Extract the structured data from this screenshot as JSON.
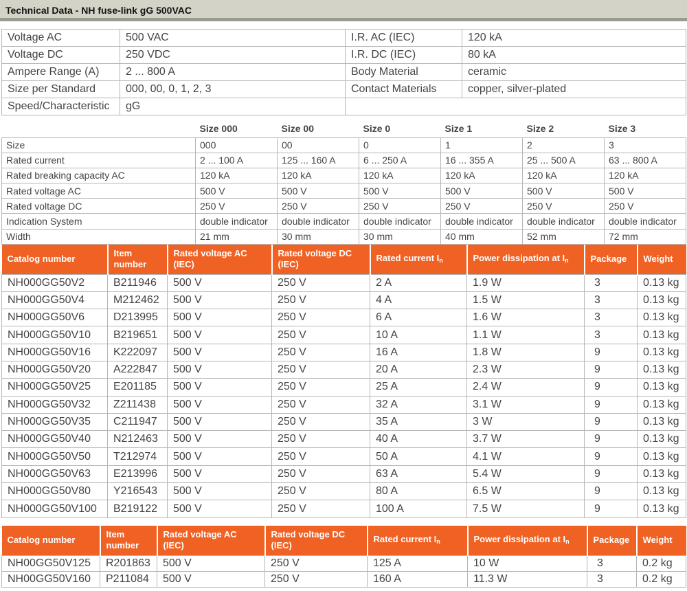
{
  "title": "Technical Data - NH fuse-link gG 500VAC",
  "overview": {
    "rows": [
      [
        {
          "l": "Voltage AC",
          "v": "500 VAC"
        },
        {
          "l": "I.R. AC (IEC)",
          "v": "120 kA"
        }
      ],
      [
        {
          "l": "Voltage DC",
          "v": "250 VDC"
        },
        {
          "l": "I.R. DC (IEC)",
          "v": "80 kA"
        }
      ],
      [
        {
          "l": "Ampere Range (A)",
          "v": "2 ... 800 A"
        },
        {
          "l": "Body Material",
          "v": "ceramic"
        }
      ],
      [
        {
          "l": "Size per Standard",
          "v": "000, 00, 0, 1, 2, 3"
        },
        {
          "l": "Contact Materials",
          "v": "copper, silver-plated"
        }
      ],
      [
        {
          "l": "Speed/Characteristic",
          "v": "gG"
        },
        null
      ]
    ]
  },
  "sizes": {
    "headers": [
      "Size 000",
      "Size 00",
      "Size 0",
      "Size 1",
      "Size 2",
      "Size 3"
    ],
    "rows": [
      {
        "label": "Size",
        "values": [
          "000",
          "00",
          "0",
          "1",
          "2",
          "3"
        ]
      },
      {
        "label": "Rated current",
        "values": [
          "2 ... 100 A",
          "125 ... 160 A",
          "6 ... 250 A",
          "16 ... 355 A",
          "25 ... 500 A",
          "63 ... 800 A"
        ]
      },
      {
        "label": "Rated breaking capacity AC",
        "values": [
          "120 kA",
          "120 kA",
          "120 kA",
          "120 kA",
          "120 kA",
          "120 kA"
        ]
      },
      {
        "label": "Rated voltage AC",
        "values": [
          "500 V",
          "500 V",
          "500 V",
          "500 V",
          "500 V",
          "500 V"
        ]
      },
      {
        "label": "Rated voltage DC",
        "values": [
          "250 V",
          "250 V",
          "250 V",
          "250 V",
          "250 V",
          "250 V"
        ]
      },
      {
        "label": "Indication System",
        "values": [
          "double indicator",
          "double indicator",
          "double indicator",
          "double indicator",
          "double indicator",
          "double indicator"
        ]
      },
      {
        "label": "Width",
        "values": [
          "21 mm",
          "30 mm",
          "30 mm",
          "40 mm",
          "52 mm",
          "72 mm"
        ]
      }
    ]
  },
  "product_headers": {
    "catalog": "Catalog number",
    "item": "Item number",
    "vac": "Rated voltage AC (IEC)",
    "vdc": "Rated voltage DC (IEC)",
    "current": "Rated current I",
    "current_sub": "n",
    "power": "Power dissipation at I",
    "power_sub": "n",
    "package": "Package",
    "weight": "Weight"
  },
  "products_000": [
    [
      "NH000GG50V2",
      "B211946",
      "500 V",
      "250 V",
      "2 A",
      "1.9 W",
      "3",
      "0.13 kg"
    ],
    [
      "NH000GG50V4",
      "M212462",
      "500 V",
      "250 V",
      "4 A",
      "1.5 W",
      "3",
      "0.13 kg"
    ],
    [
      "NH000GG50V6",
      "D213995",
      "500 V",
      "250 V",
      "6 A",
      "1.6 W",
      "3",
      "0.13 kg"
    ],
    [
      "NH000GG50V10",
      "B219651",
      "500 V",
      "250 V",
      "10 A",
      "1.1 W",
      "3",
      "0.13 kg"
    ],
    [
      "NH000GG50V16",
      "K222097",
      "500 V",
      "250 V",
      "16 A",
      "1.8 W",
      "9",
      "0.13 kg"
    ],
    [
      "NH000GG50V20",
      "A222847",
      "500 V",
      "250 V",
      "20 A",
      "2.3 W",
      "9",
      "0.13 kg"
    ],
    [
      "NH000GG50V25",
      "E201185",
      "500 V",
      "250 V",
      "25 A",
      "2.4 W",
      "9",
      "0.13 kg"
    ],
    [
      "NH000GG50V32",
      "Z211438",
      "500 V",
      "250 V",
      "32 A",
      "3.1 W",
      "9",
      "0.13 kg"
    ],
    [
      "NH000GG50V35",
      "C211947",
      "500 V",
      "250 V",
      "35 A",
      "3 W",
      "9",
      "0.13 kg"
    ],
    [
      "NH000GG50V40",
      "N212463",
      "500 V",
      "250 V",
      "40 A",
      "3.7 W",
      "9",
      "0.13 kg"
    ],
    [
      "NH000GG50V50",
      "T212974",
      "500 V",
      "250 V",
      "50 A",
      "4.1 W",
      "9",
      "0.13 kg"
    ],
    [
      "NH000GG50V63",
      "E213996",
      "500 V",
      "250 V",
      "63 A",
      "5.4 W",
      "9",
      "0.13 kg"
    ],
    [
      "NH000GG50V80",
      "Y216543",
      "500 V",
      "250 V",
      "80 A",
      "6.5 W",
      "9",
      "0.13 kg"
    ],
    [
      "NH000GG50V100",
      "B219122",
      "500 V",
      "250 V",
      "100 A",
      "7.5 W",
      "9",
      "0.13 kg"
    ]
  ],
  "products_00": [
    [
      "NH00GG50V125",
      "R201863",
      "500 V",
      "250 V",
      "125 A",
      "10 W",
      "3",
      "0.2 kg"
    ],
    [
      "NH00GG50V160",
      "P211084",
      "500 V",
      "250 V",
      "160 A",
      "11.3 W",
      "3",
      "0.2 kg"
    ]
  ]
}
